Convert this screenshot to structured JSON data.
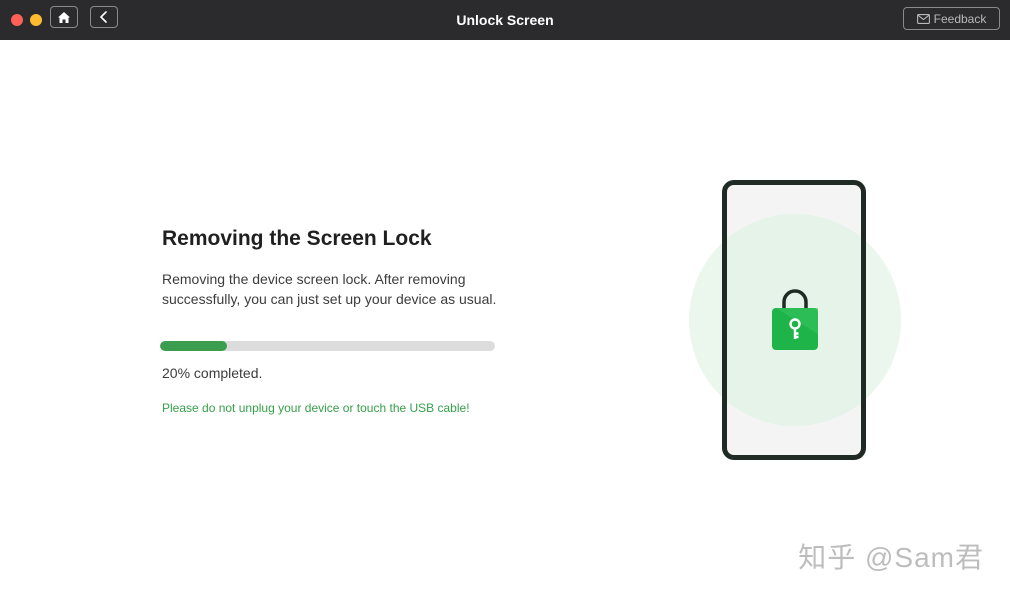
{
  "window": {
    "title": "Unlock Screen",
    "feedback_label": "Feedback"
  },
  "content": {
    "heading": "Removing the Screen Lock",
    "description": "Removing the device screen lock. After removing successfully, you can just set up your device as usual.",
    "progress": {
      "percent": 20,
      "label": "20% completed."
    },
    "warning": "Please do not unplug your device or touch the USB cable!"
  },
  "illustration": {
    "icons": [
      "phone-icon",
      "padlock-key-icon"
    ]
  },
  "watermark": "知乎 @Sam君",
  "colors": {
    "titlebar": "#2b2b2d",
    "accent_green": "#3b9d4e",
    "warning_green": "#35a04a",
    "close": "#fe5f57",
    "minimize": "#febc2e"
  }
}
